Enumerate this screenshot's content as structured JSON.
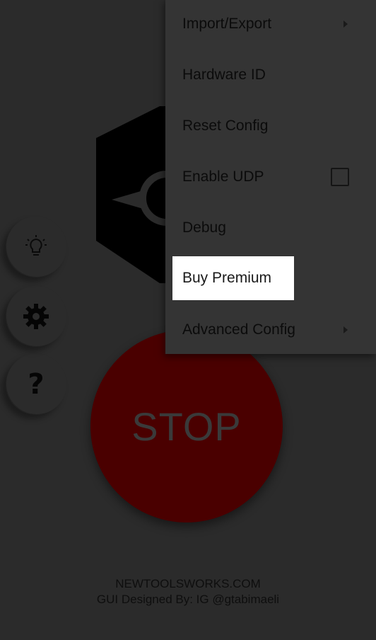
{
  "menu": {
    "items": [
      {
        "label": "Import/Export",
        "has_submenu": true
      },
      {
        "label": "Hardware ID",
        "has_submenu": false
      },
      {
        "label": "Reset Config",
        "has_submenu": false
      },
      {
        "label": "Enable UDP",
        "checkbox": true,
        "checked": false
      },
      {
        "label": "Debug",
        "has_submenu": false
      },
      {
        "label": "Buy Premium",
        "highlighted": true
      },
      {
        "label": "Advanced Config",
        "has_submenu": true
      }
    ]
  },
  "side_buttons": [
    {
      "icon": "lightbulb-icon"
    },
    {
      "icon": "gear-icon"
    },
    {
      "icon": "question-icon",
      "glyph": "?"
    }
  ],
  "main": {
    "stop_label": "STOP"
  },
  "footer": {
    "line1": "NEWTOOLSWORKS.COM",
    "line2": "GUI  Designed By: IG @gtabimaeli"
  },
  "colors": {
    "background": "#2b2b2b",
    "stop_button": "#4a0000",
    "menu_bg": "#343434",
    "highlight": "#ffffff"
  }
}
